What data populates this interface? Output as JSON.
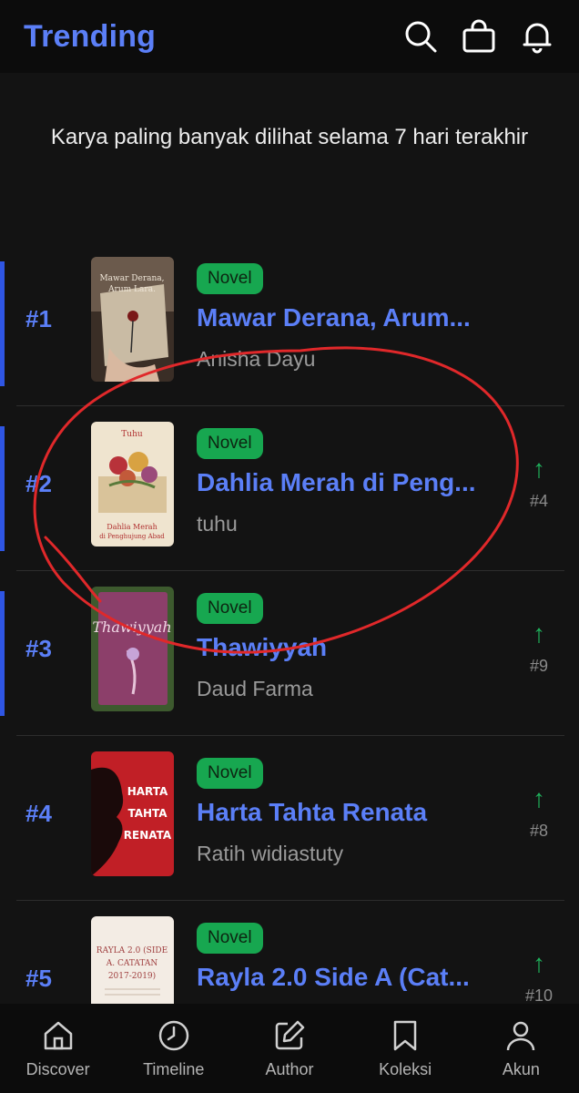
{
  "header": {
    "title": "Trending",
    "icons": [
      "search-icon",
      "shopping-bag-icon",
      "bell-icon"
    ]
  },
  "subtitle": "Karya paling banyak dilihat selama 7 hari terakhir",
  "books": [
    {
      "rank": "#1",
      "badge": "Novel",
      "title": "Mawar Derana, Arum...",
      "author": "Anisha Dayu",
      "trend": null
    },
    {
      "rank": "#2",
      "badge": "Novel",
      "title": "Dahlia Merah di Peng...",
      "author": "tuhu",
      "trend": {
        "arrow": "↑",
        "prev": "#4"
      }
    },
    {
      "rank": "#3",
      "badge": "Novel",
      "title": "Thawiyyah",
      "author": "Daud Farma",
      "trend": {
        "arrow": "↑",
        "prev": "#9"
      }
    },
    {
      "rank": "#4",
      "badge": "Novel",
      "title": "Harta Tahta Renata",
      "author": "Ratih widiastuty",
      "trend": {
        "arrow": "↑",
        "prev": "#8"
      }
    },
    {
      "rank": "#5",
      "badge": "Novel",
      "title": "Rayla 2.0 Side A (Cat...",
      "author": "",
      "trend": {
        "arrow": "↑",
        "prev": "#10"
      }
    }
  ],
  "bottom_nav": [
    {
      "label": "Discover",
      "icon": "home-icon"
    },
    {
      "label": "Timeline",
      "icon": "clock-icon"
    },
    {
      "label": "Author",
      "icon": "edit-icon"
    },
    {
      "label": "Koleksi",
      "icon": "bookmark-icon"
    },
    {
      "label": "Akun",
      "icon": "user-icon"
    }
  ],
  "colors": {
    "accent": "#5b7ff7",
    "badge_green": "#17a750",
    "trend_green": "#1fb35d",
    "background": "#131313"
  }
}
